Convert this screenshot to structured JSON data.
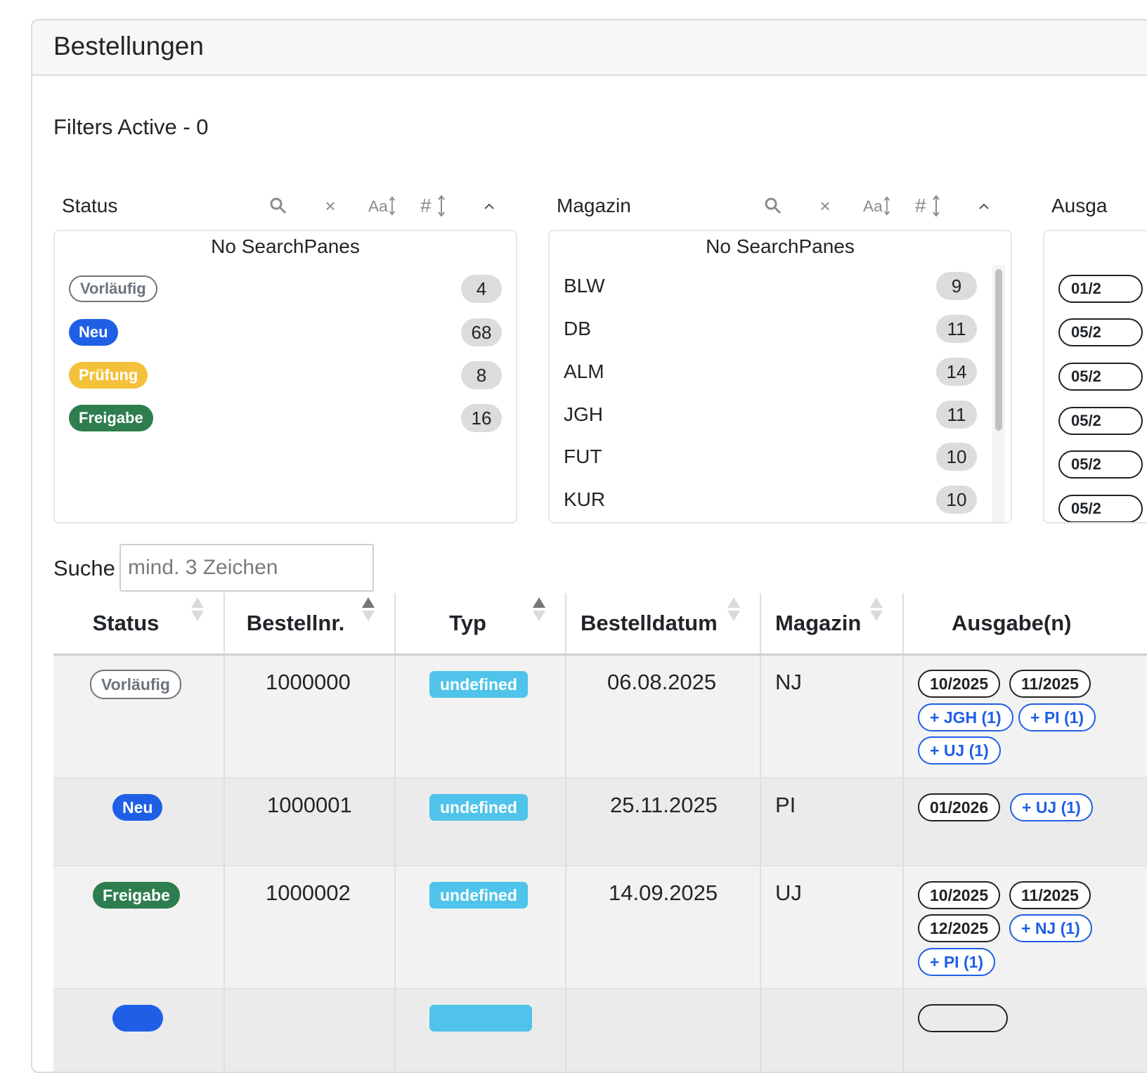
{
  "card": {
    "title": "Bestellungen"
  },
  "filters": {
    "active_label": "Filters Active - 0"
  },
  "panes": {
    "status": {
      "title": "Status",
      "message": "No SearchPanes",
      "items": [
        {
          "label": "Vorläufig",
          "count": "4"
        },
        {
          "label": "Neu",
          "count": "68"
        },
        {
          "label": "Prüfung",
          "count": "8"
        },
        {
          "label": "Freigabe",
          "count": "16"
        }
      ]
    },
    "magazin": {
      "title": "Magazin",
      "message": "No SearchPanes",
      "items": [
        {
          "label": "BLW",
          "count": "9"
        },
        {
          "label": "DB",
          "count": "11"
        },
        {
          "label": "ALM",
          "count": "14"
        },
        {
          "label": "JGH",
          "count": "11"
        },
        {
          "label": "FUT",
          "count": "10"
        },
        {
          "label": "KUR",
          "count": "10"
        }
      ]
    },
    "ausgabe": {
      "title": "Ausga",
      "items": [
        "01/2",
        "05/2",
        "05/2",
        "05/2",
        "05/2",
        "05/2"
      ]
    },
    "icons": {
      "search": "search-icon",
      "clear": "close-icon",
      "sort_alpha": "sort-alpha-icon",
      "sort_num": "sort-numeric-icon",
      "collapse": "chevron-up-icon"
    }
  },
  "search": {
    "label": "Suche",
    "placeholder": "mind. 3 Zeichen",
    "value": ""
  },
  "table": {
    "headers": {
      "status": "Status",
      "bestellnr": "Bestellnr.",
      "typ": "Typ",
      "bestelldatum": "Bestelldatum",
      "magazin": "Magazin",
      "ausgaben": "Ausgabe(n)"
    },
    "rows": [
      {
        "status": "Vorläufig",
        "bestellnr": "1000000",
        "typ": "undefined",
        "bestelldatum": "06.08.2025",
        "magazin": "NJ",
        "pills": [
          "10/2025",
          "11/2025",
          "+ JGH (1)",
          "+ PI (1)",
          "+ UJ (1)"
        ]
      },
      {
        "status": "Neu",
        "bestellnr": "1000001",
        "typ": "undefined",
        "bestelldatum": "25.11.2025",
        "magazin": "PI",
        "pills": [
          "01/2026",
          "+ UJ (1)"
        ]
      },
      {
        "status": "Freigabe",
        "bestellnr": "1000002",
        "typ": "undefined",
        "bestelldatum": "14.09.2025",
        "magazin": "UJ",
        "pills": [
          "10/2025",
          "11/2025",
          "12/2025",
          "+ NJ (1)",
          "+ PI (1)"
        ]
      }
    ]
  },
  "colors": {
    "vorlaeufig": "#6c757d",
    "neu": "#1f5fe6",
    "pruefung": "#f3c13a",
    "freigabe": "#2e7d4f",
    "typ": "#4fc3ea"
  }
}
